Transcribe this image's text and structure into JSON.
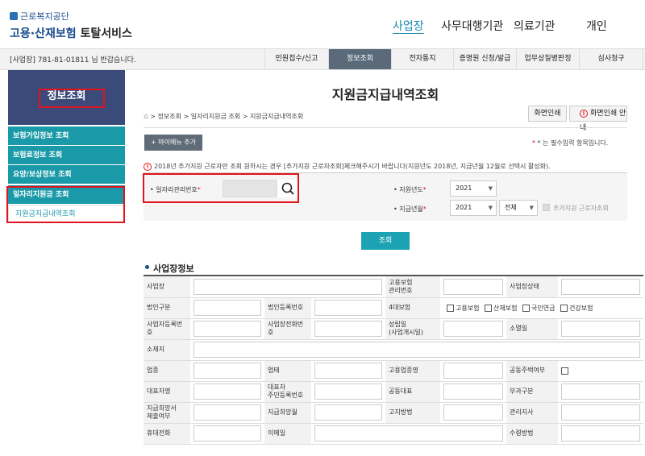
{
  "logo": {
    "sub": "근로복지공단",
    "main_a": "고용·산재보험",
    "main_b": "토탈서비스"
  },
  "topnav": [
    "사업장",
    "사무대행기관",
    "의료기관",
    "개인"
  ],
  "bar": {
    "bizinfo": "[사업장] 781-81-01811 님 반갑습니다.",
    "tabs": [
      "민원접수/신고",
      "정보조회",
      "전자통지",
      "증명원 신청/발급",
      "업무상질병판정",
      "심사청구"
    ]
  },
  "sidebar": {
    "title": "정보조회",
    "items": [
      "보험가입정보 조회",
      "보험료정보 조회",
      "요양/보상정보 조회",
      "일자리지원금 조회"
    ],
    "sub": "지원금지급내역조회"
  },
  "page": {
    "title": "지원금지급내역조회",
    "print": "화면인쇄",
    "print_guide": "화면인쇄 안내",
    "breadcrumb": "> 정보조회 > 일자리지원금 조회 > 지원금지급내역조회",
    "mymenu": "+ 마이메뉴 추가",
    "required": "* 는 필수입력 항목입니다.",
    "notice": "2018년 추가지원 근로자만 조회 원하시는 경우 [추가지원 근로자조회]체크해주시기 바랍니다(지원년도 2018년, 지급년월 12월로 선택시 활성화)."
  },
  "form": {
    "job_label": "• 일자리관리번호",
    "year_label": "• 지원년도",
    "month_label": "• 지급년월",
    "year_value": "2021",
    "month_year": "2021",
    "month_value": "전체",
    "extra_check": "추가지원 근로자조회",
    "query": "조회"
  },
  "section": {
    "title": "사업장정보",
    "rows": [
      [
        "사업장",
        "",
        "고용보험\n관리번호",
        "",
        "사업장상태",
        ""
      ],
      [
        "법인구분",
        "",
        "법인등록번호",
        "",
        "4대보험",
        "CHECKS"
      ],
      [
        "사업자등록번\n호",
        "",
        "사업장전화번\n호",
        "",
        "성립일\n(사업개시일)",
        "",
        "소멸일",
        ""
      ],
      [
        "소재지",
        "WIDE"
      ],
      [
        "업종",
        "",
        "업태",
        "",
        "고용업종명",
        "",
        "공동주택여부",
        "CB"
      ],
      [
        "대표자명",
        "",
        "대표자\n주민등록번호",
        "",
        "공동대표",
        "",
        "부과구분",
        ""
      ],
      [
        "지급희망서\n제출여부",
        "",
        "지급희망월",
        "",
        "고지방법",
        "",
        "관리지사",
        ""
      ],
      [
        "휴대전화",
        "",
        "이메일",
        "",
        "",
        "",
        "수령방법",
        ""
      ]
    ],
    "insurance": [
      "고용보험",
      "산재보험",
      "국민연금",
      "건강보험"
    ]
  }
}
